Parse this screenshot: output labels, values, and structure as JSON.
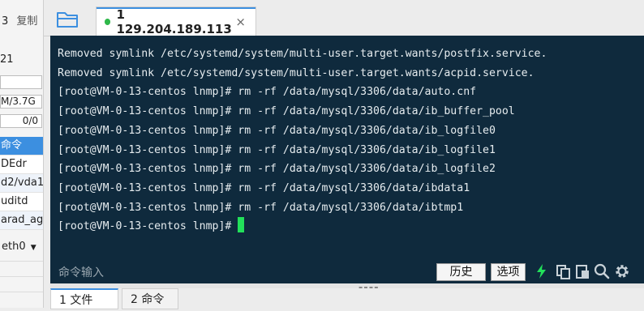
{
  "left_panel": {
    "top_partial": "3",
    "copy_label": "复制",
    "partial_value": "21",
    "mem_value": "M/3.7G",
    "swap_value": "0/0",
    "process_header": "命令",
    "processes": [
      "DEdr",
      "d2/vda1",
      "uditd",
      "arad_age"
    ],
    "network_interface": "eth0"
  },
  "tab_bar": {
    "session_tab_label": "1 129.204.189.113",
    "close_glyph": "×"
  },
  "terminal": {
    "lines": [
      "Removed symlink /etc/systemd/system/multi-user.target.wants/postfix.service.",
      "Removed symlink /etc/systemd/system/multi-user.target.wants/acpid.service.",
      "[root@VM-0-13-centos lnmp]# rm -rf /data/mysql/3306/data/auto.cnf",
      "[root@VM-0-13-centos lnmp]# rm -rf /data/mysql/3306/data/ib_buffer_pool",
      "[root@VM-0-13-centos lnmp]# rm -rf /data/mysql/3306/data/ib_logfile0",
      "[root@VM-0-13-centos lnmp]# rm -rf /data/mysql/3306/data/ib_logfile1",
      "[root@VM-0-13-centos lnmp]# rm -rf /data/mysql/3306/data/ib_logfile2",
      "[root@VM-0-13-centos lnmp]# rm -rf /data/mysql/3306/data/ibdata1",
      "[root@VM-0-13-centos lnmp]# rm -rf /data/mysql/3306/data/ibtmp1"
    ],
    "prompt": "[root@VM-0-13-centos lnmp]# "
  },
  "command_bar": {
    "label": "命令输入",
    "history_button": "历史",
    "options_button": "选项",
    "icons": [
      "lightning-icon",
      "copy-icon",
      "paste-icon",
      "search-icon",
      "gear-icon"
    ]
  },
  "bottom_tabs": {
    "files": "1 文件",
    "commands": "2 命令"
  },
  "colors": {
    "terminal_bg": "#0f2a3d",
    "accent": "#3c8fe0",
    "connected": "#2fb84a",
    "cursor": "#22e05a"
  }
}
